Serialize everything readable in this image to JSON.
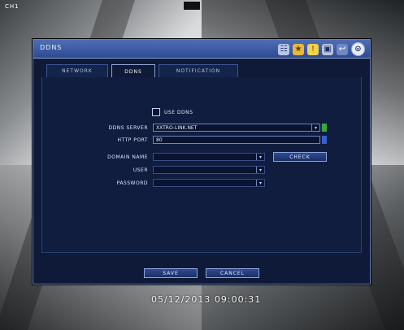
{
  "camera": {
    "channel_label": "CH1"
  },
  "dialog": {
    "title": "DDNS",
    "toolbar_icons": [
      "network-icon",
      "favorites-icon",
      "warning-icon",
      "monitor-icon",
      "return-icon",
      "close-icon"
    ]
  },
  "tabs": [
    {
      "label": "NETWORK",
      "active": false
    },
    {
      "label": "DDNS",
      "active": true
    },
    {
      "label": "NOTIFICATION",
      "active": false
    }
  ],
  "form": {
    "use_ddns": {
      "label": "USE DDNS",
      "checked": false
    },
    "ddns_server": {
      "label": "DDNS SERVER",
      "value": "XXTRO-LINK.NET"
    },
    "http_port": {
      "label": "HTTP PORT",
      "value": "80"
    },
    "domain_name": {
      "label": "DOMAIN NAME",
      "value": ""
    },
    "check_button": "CHECK",
    "user": {
      "label": "USER",
      "value": ""
    },
    "password": {
      "label": "PASSWORD",
      "value": ""
    }
  },
  "buttons": {
    "save": "SAVE",
    "cancel": "CANCEL"
  },
  "timestamp": "05/12/2013 09:00:31"
}
